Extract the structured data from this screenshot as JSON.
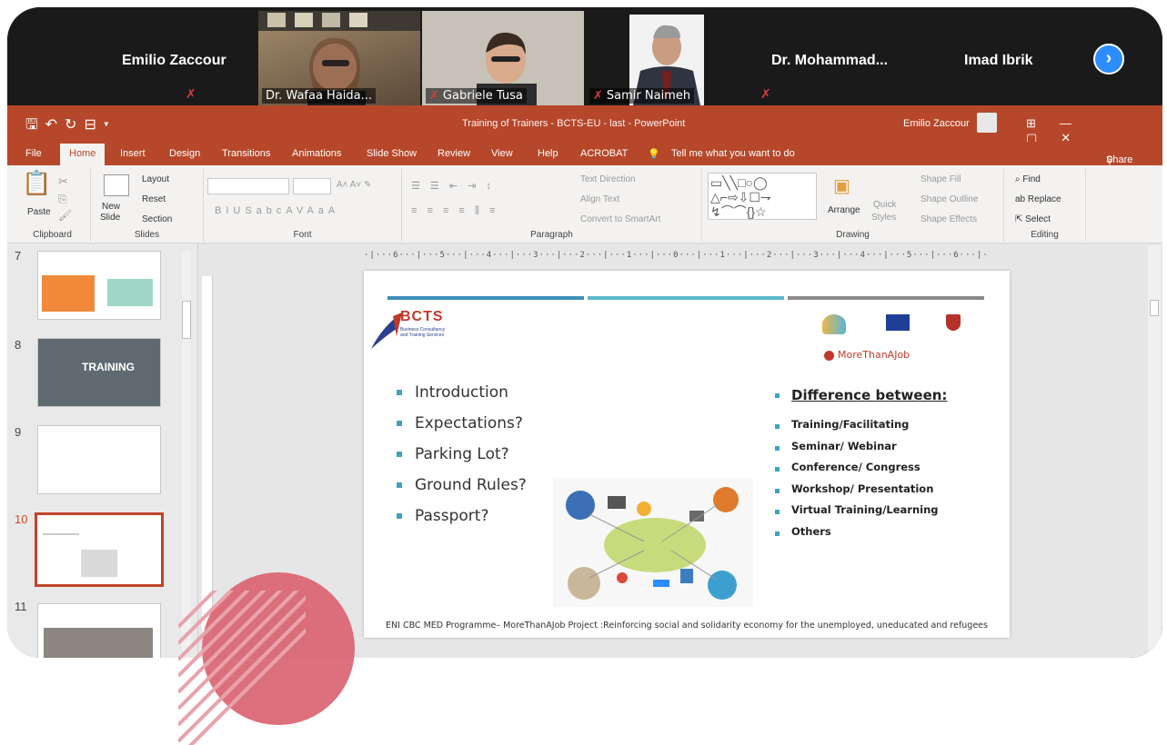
{
  "zoom": {
    "participants": [
      {
        "name": "Emilio Zaccour",
        "video": false
      },
      {
        "name": "Dr. Wafaa Haida...",
        "video": true
      },
      {
        "name": "Gabriele Tusa",
        "video": true
      },
      {
        "name": "Samir Naimeh",
        "video": true
      },
      {
        "name": "Dr. Mohammad...",
        "video": false
      },
      {
        "name": "Imad Ibrik",
        "video": false
      }
    ]
  },
  "powerpoint": {
    "window_title": "Training of Trainers - BCTS-EU - last - PowerPoint",
    "user": "Emilio Zaccour",
    "menu": [
      "File",
      "Home",
      "Insert",
      "Design",
      "Transitions",
      "Animations",
      "Slide Show",
      "Review",
      "View",
      "Help",
      "ACROBAT"
    ],
    "tell_me": "Tell me what you want to do",
    "share": "Share",
    "ribbon": {
      "clipboard": {
        "label": "Clipboard",
        "paste": "Paste"
      },
      "slides": {
        "label": "Slides",
        "new_slide": "New",
        "new_slide2": "Slide",
        "layout": "Layout",
        "reset": "Reset",
        "section": "Section"
      },
      "font": {
        "label": "Font"
      },
      "paragraph": {
        "label": "Paragraph",
        "text_direction": "Text Direction",
        "align_text": "Align Text",
        "convert": "Convert to SmartArt"
      },
      "drawing": {
        "label": "Drawing",
        "arrange": "Arrange",
        "quick_styles": "Quick",
        "quick_styles2": "Styles",
        "shape_fill": "Shape Fill",
        "shape_outline": "Shape Outline",
        "shape_effects": "Shape Effects"
      },
      "editing": {
        "label": "Editing",
        "find": "Find",
        "replace": "Replace",
        "select": "Select"
      }
    },
    "slide_numbers": [
      "7",
      "8",
      "9",
      "10",
      "11"
    ],
    "selected_slide": "10",
    "slide": {
      "logo_title": "BCTS",
      "logo_sub1": "Business Consultancy",
      "logo_sub2": "and Training Services",
      "partner_text": "MoreThanAJob",
      "left_bullets": [
        "Introduction",
        "Expectations?",
        "Parking Lot?",
        "Ground Rules?",
        "Passport?"
      ],
      "right_heading": "Difference between:",
      "right_bullets": [
        "Training/Facilitating",
        "Seminar/ Webinar",
        "Conference/ Congress",
        "Workshop/ Presentation",
        "Virtual Training/Learning",
        "Others"
      ],
      "footer": "ENI CBC MED Programme– MoreThanAJob Project :Reinforcing social and solidarity economy for the unemployed, uneducated and refugees"
    },
    "thumb8_text": "TRAINING",
    "colors": {
      "accent": "#b7472a",
      "bar1": "#3f8fb6",
      "bar2": "#5cb7cf",
      "bar3": "#8a8a8a"
    }
  }
}
